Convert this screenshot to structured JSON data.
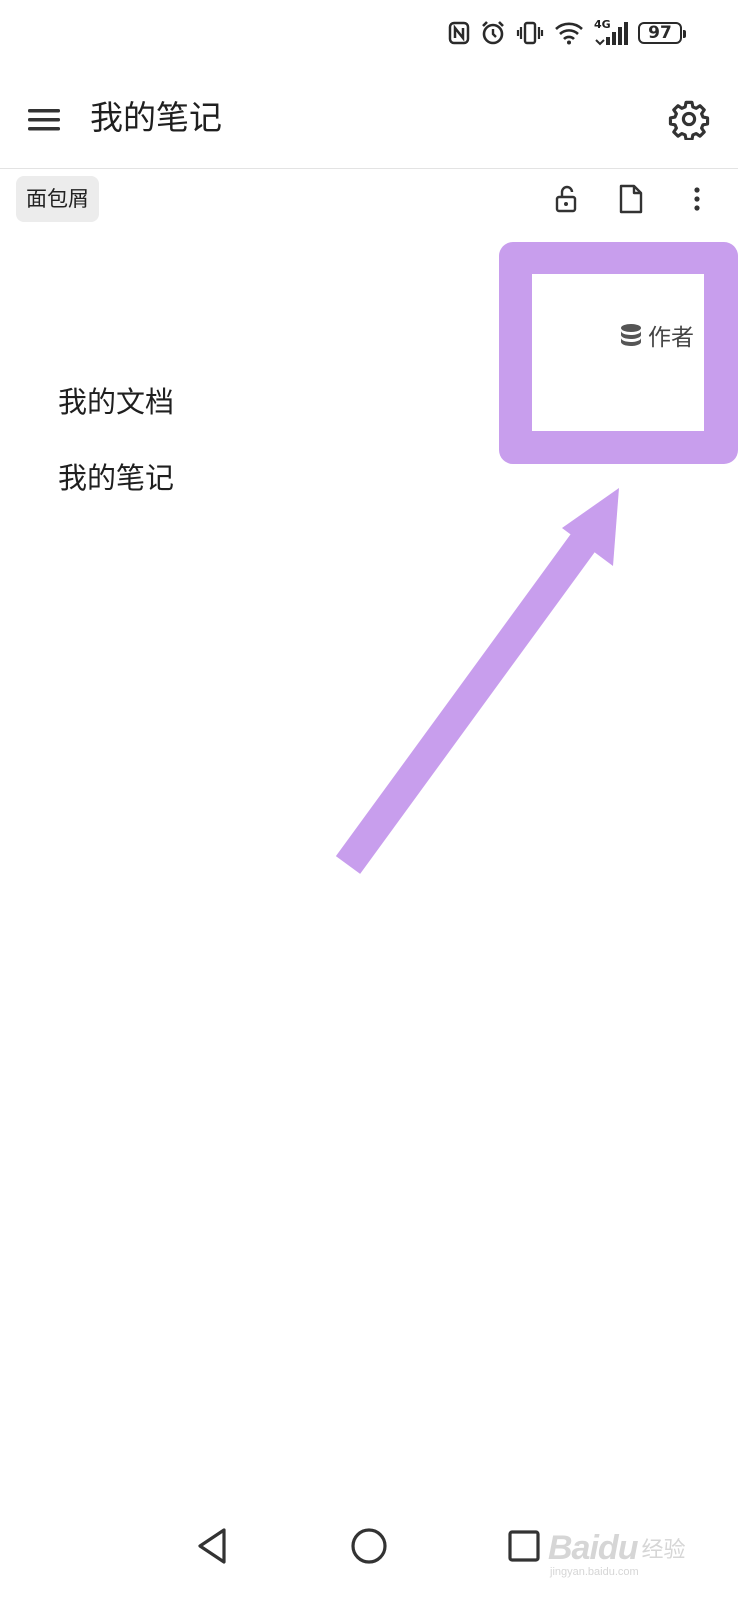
{
  "status_bar": {
    "battery_level": "97",
    "network_label": "4G",
    "icons": [
      "nfc-icon",
      "alarm-icon",
      "vibrate-icon",
      "wifi-icon",
      "signal-icon",
      "battery-icon"
    ]
  },
  "app_bar": {
    "title": "我的笔记",
    "menu_icon": "hamburger-icon",
    "settings_icon": "gear-icon"
  },
  "toolbar": {
    "breadcrumb_label": "面包屑",
    "icons": [
      "unlock-icon",
      "document-icon",
      "more-vertical-icon"
    ]
  },
  "popup": {
    "item_label": "作者",
    "item_icon": "database-icon",
    "highlight_color": "#c89eed"
  },
  "list": {
    "items": [
      {
        "label": "我的文档"
      },
      {
        "label": "我的笔记"
      }
    ]
  },
  "annotation": {
    "arrow_color": "#c89eed"
  },
  "nav_bar": {
    "icons": [
      "back-triangle-icon",
      "home-circle-icon",
      "recent-square-icon"
    ]
  },
  "watermark": {
    "brand": "Bai",
    "paw_char": "du",
    "cn_label": "经验",
    "url": "jingyan.baidu.com"
  }
}
